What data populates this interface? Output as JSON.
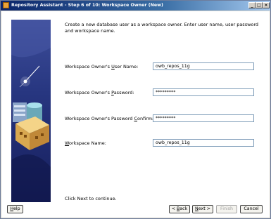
{
  "window": {
    "title": "Repository Assistant - Step 6 of 10: Workspace Owner (New)",
    "minimize": "_",
    "maximize": "□",
    "close": "×"
  },
  "intro": "Create a new database user as a workspace owner. Enter user name, user password and workspace name.",
  "fields": [
    {
      "label_pre": "Workspace Owner's ",
      "label_mnemonic": "U",
      "label_post": "ser Name:",
      "value": "owb_repos_11g"
    },
    {
      "label_pre": "Workspace Owner's ",
      "label_mnemonic": "P",
      "label_post": "assword:",
      "value": "*********"
    },
    {
      "label_pre": "Workspace Owner's Password ",
      "label_mnemonic": "C",
      "label_post": "onfirmation:",
      "value": "*********"
    },
    {
      "label_pre": "",
      "label_mnemonic": "W",
      "label_post": "orkspace Name:",
      "value": "owb_repos_11g"
    }
  ],
  "footer_hint": "Click Next to continue.",
  "buttons": {
    "help_mn": "H",
    "help_rest": "elp",
    "back_pre": "< ",
    "back_mn": "B",
    "back_rest": "ack",
    "next_mn": "N",
    "next_rest": "ext >",
    "finish": "Finish",
    "cancel": "Cancel"
  }
}
